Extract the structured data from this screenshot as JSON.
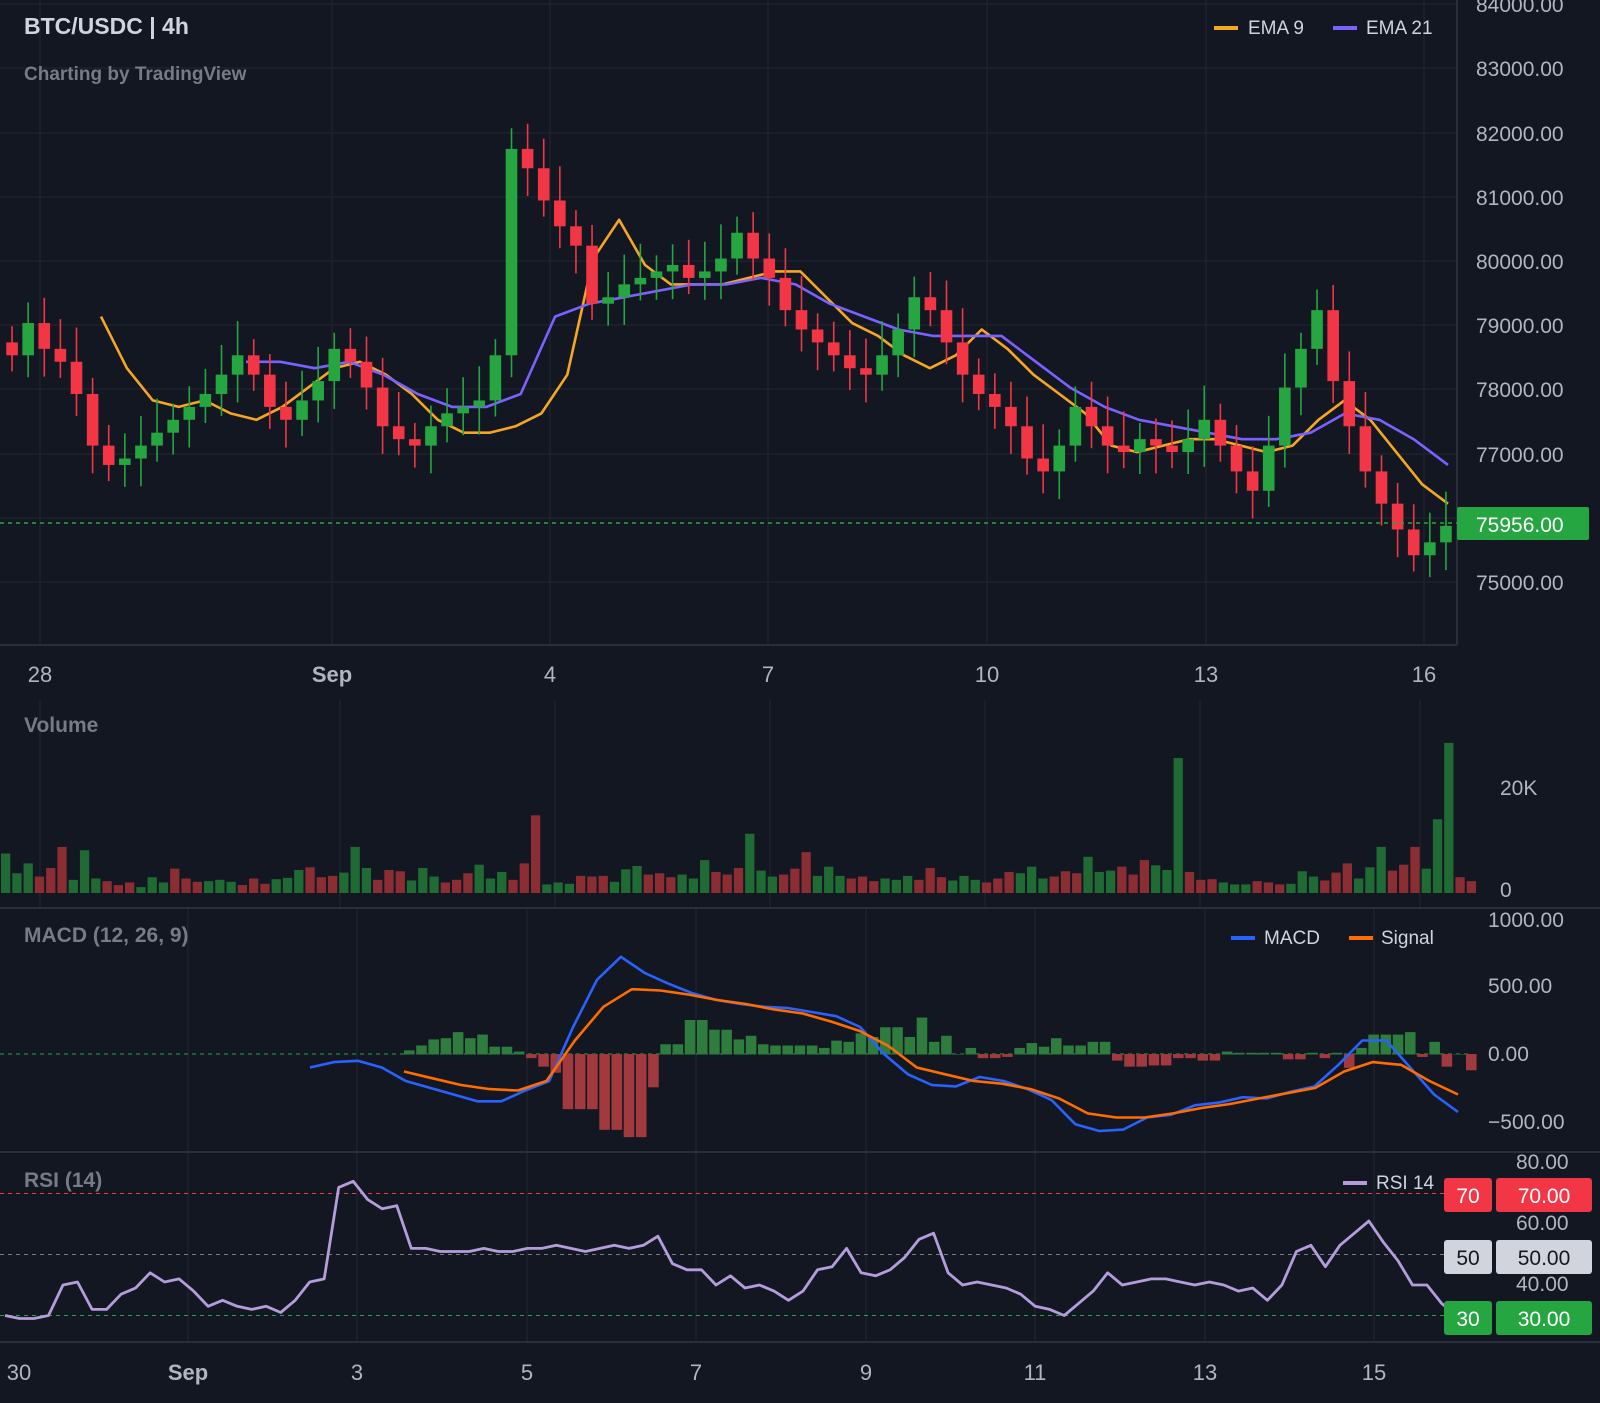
{
  "header": {
    "symbol": "BTC/USDC | 4h",
    "credit": "Charting by TradingView",
    "legend": [
      {
        "name": "EMA 9",
        "color": "#f5a623"
      },
      {
        "name": "EMA 21",
        "color": "#7b61ff"
      }
    ]
  },
  "price_axis": {
    "labels": [
      "84000.00",
      "83000.00",
      "82000.00",
      "81000.00",
      "80000.00",
      "79000.00",
      "78000.00",
      "77000.00",
      "75000.00"
    ],
    "last_price": "75956.00",
    "last_price_color": "#26a641"
  },
  "time_axis_top": [
    "28",
    "Sep",
    "4",
    "7",
    "10",
    "13",
    "16"
  ],
  "volume": {
    "title": "Volume",
    "axis": [
      "20K",
      "0"
    ]
  },
  "macd": {
    "title": "MACD (12, 26, 9)",
    "legend": [
      {
        "name": "MACD",
        "color": "#2962ff"
      },
      {
        "name": "Signal",
        "color": "#ff6d00"
      }
    ],
    "axis": [
      "1000.00",
      "500.00",
      "0.00",
      "−500.00"
    ]
  },
  "rsi": {
    "title": "RSI (14)",
    "legend": "RSI 14",
    "color": "#b39ddb",
    "axis": [
      "80.00",
      "60.00",
      "40.00"
    ],
    "level_tags": [
      {
        "left": "70",
        "right": "70.00",
        "bg": "#f23645"
      },
      {
        "left": "50",
        "right": "50.00",
        "bg": "#d1d4dc"
      },
      {
        "left": "30",
        "right": "30.00",
        "bg": "#26a641"
      }
    ]
  },
  "time_axis_bottom": [
    "30",
    "Sep",
    "3",
    "5",
    "7",
    "9",
    "11",
    "13",
    "15"
  ],
  "chart_data": [
    {
      "type": "candlestick",
      "title": "BTC/USDC | 4h",
      "ylim": [
        74000,
        84000
      ],
      "x_ticks": [
        "28",
        "Sep",
        "4",
        "7",
        "10",
        "13",
        "16"
      ],
      "close_series": [
        78600,
        79100,
        78700,
        78500,
        78000,
        77200,
        76900,
        77000,
        77200,
        77400,
        77600,
        77800,
        78000,
        78300,
        78600,
        78300,
        77800,
        77600,
        77900,
        78200,
        78700,
        78500,
        78100,
        77500,
        77300,
        77200,
        77500,
        77700,
        77800,
        77900,
        78600,
        81800,
        81500,
        81000,
        80600,
        80300,
        79400,
        79500,
        79700,
        79800,
        79900,
        80000,
        79800,
        79900,
        80100,
        80500,
        80100,
        79800,
        79300,
        79000,
        78800,
        78600,
        78400,
        78300,
        78600,
        79000,
        79500,
        79300,
        78800,
        78300,
        78000,
        77800,
        77500,
        77000,
        76800,
        77200,
        77800,
        77500,
        77200,
        77100,
        77300,
        77200,
        77100,
        77300,
        77600,
        77200,
        76800,
        76500,
        77200,
        78100,
        78700,
        79300,
        78200,
        77500,
        76800,
        76300,
        75900,
        75500,
        75700,
        75956
      ],
      "ema9": [
        79200,
        78400,
        77900,
        77800,
        77900,
        77700,
        77600,
        77800,
        78100,
        78400,
        78500,
        78300,
        78000,
        77600,
        77400,
        77400,
        77500,
        77700,
        78300,
        80100,
        80700,
        80000,
        79700,
        79700,
        79700,
        79800,
        79900,
        79900,
        79500,
        79100,
        78900,
        78600,
        78400,
        78600,
        79000,
        78700,
        78300,
        78000,
        77700,
        77200,
        77100,
        77200,
        77300,
        77300,
        77200,
        77100,
        77200,
        77600,
        77900,
        77600,
        77100,
        76600,
        76300
      ],
      "ema21": [
        78500,
        78500,
        78400,
        78500,
        78300,
        78000,
        77800,
        77800,
        78000,
        79200,
        79400,
        79500,
        79600,
        79700,
        79700,
        79800,
        79700,
        79400,
        79200,
        79000,
        78900,
        78900,
        78900,
        78500,
        78100,
        77800,
        77600,
        77500,
        77400,
        77300,
        77300,
        77400,
        77700,
        77600,
        77300,
        76900
      ],
      "last_price": 75956
    },
    {
      "type": "bar",
      "title": "Volume",
      "ylim": [
        0,
        30000
      ],
      "values": [
        6000,
        3000,
        4500,
        2500,
        3800,
        7000,
        2000,
        6500,
        2200,
        1800,
        1200,
        1600,
        900,
        2400,
        1600,
        3700,
        2200,
        1700,
        1800,
        2000,
        1700,
        1200,
        2200,
        1400,
        2100,
        2300,
        3500,
        3900,
        2400,
        2600,
        3100,
        7000,
        3800,
        2000,
        3500,
        3300,
        1900,
        3800,
        2500,
        1600,
        2000,
        3000,
        4300,
        2200,
        3200,
        2000,
        4500,
        11800,
        1300,
        1600,
        1400,
        2600,
        2500,
        2600,
        1700,
        3600,
        4100,
        2800,
        3000,
        2400,
        2800,
        2200,
        5000,
        3200,
        2800,
        3800,
        9000,
        3400,
        2500,
        2800,
        3700,
        6200,
        2600,
        4000,
        2600,
        2200,
        2500,
        1800,
        2200,
        2000,
        2600,
        2000,
        3800,
        2400,
        1900,
        2600,
        2000,
        1600,
        2200,
        3200,
        3000,
        4000,
        2200,
        2500,
        3300,
        3000,
        5500,
        3200,
        3400,
        4000,
        2800,
        5000,
        4200,
        3500,
        20500,
        3200,
        2000,
        2100,
        1600,
        1300,
        1300,
        1800,
        1600,
        1300,
        1400,
        3300,
        2500,
        1900,
        3100,
        4500,
        2200,
        3900,
        7000,
        3400,
        4300,
        7000,
        3700,
        11200,
        22800,
        2400,
        1800
      ],
      "colors_note": "green=up, red=down"
    },
    {
      "type": "line",
      "title": "MACD (12, 26, 9)",
      "ylim": [
        -700,
        1000
      ],
      "series": [
        {
          "name": "MACD",
          "values": [
            -100,
            -60,
            -50,
            -100,
            -200,
            -250,
            -300,
            -350,
            -350,
            -270,
            -200,
            200,
            550,
            720,
            600,
            520,
            450,
            400,
            370,
            350,
            340,
            310,
            280,
            200,
            0,
            -150,
            -230,
            -240,
            -170,
            -200,
            -260,
            -340,
            -520,
            -570,
            -560,
            -470,
            -450,
            -380,
            -360,
            -320,
            -330,
            -280,
            -240,
            -80,
            100,
            100,
            -100,
            -300,
            -430
          ]
        },
        {
          "name": "Signal",
          "values": [
            -130,
            -180,
            -230,
            -260,
            -270,
            -200,
            100,
            350,
            480,
            470,
            440,
            400,
            370,
            330,
            300,
            240,
            170,
            60,
            -100,
            -150,
            -200,
            -220,
            -260,
            -330,
            -440,
            -470,
            -470,
            -440,
            -400,
            -370,
            -330,
            -290,
            -250,
            -130,
            -60,
            -80,
            -200,
            -300
          ]
        }
      ]
    },
    {
      "type": "line",
      "title": "RSI (14)",
      "ylim": [
        20,
        80
      ],
      "x_ticks": [
        "30",
        "Sep",
        "3",
        "5",
        "7",
        "9",
        "11",
        "13",
        "15"
      ],
      "series": [
        {
          "name": "RSI 14",
          "values": [
            30,
            29,
            29,
            30,
            40,
            41,
            32,
            32,
            37,
            39,
            44,
            41,
            42,
            38,
            33,
            35,
            33,
            32,
            33,
            31,
            35,
            41,
            42,
            72,
            74,
            68,
            65,
            66,
            52,
            52,
            51,
            51,
            51,
            52,
            51,
            51,
            52,
            52,
            53,
            52,
            51,
            52,
            53,
            52,
            53,
            56,
            47,
            45,
            45,
            40,
            43,
            39,
            40,
            38,
            35,
            38,
            45,
            46,
            52,
            44,
            43,
            45,
            49,
            55,
            57,
            44,
            40,
            41,
            40,
            39,
            37,
            33,
            32,
            30,
            34,
            38,
            44,
            40,
            41,
            42,
            42,
            41,
            40,
            41,
            40,
            38,
            39,
            35,
            40,
            51,
            53,
            46,
            53,
            57,
            61,
            54,
            48,
            40,
            40,
            34,
            30,
            30,
            32
          ]
        }
      ]
    }
  ]
}
